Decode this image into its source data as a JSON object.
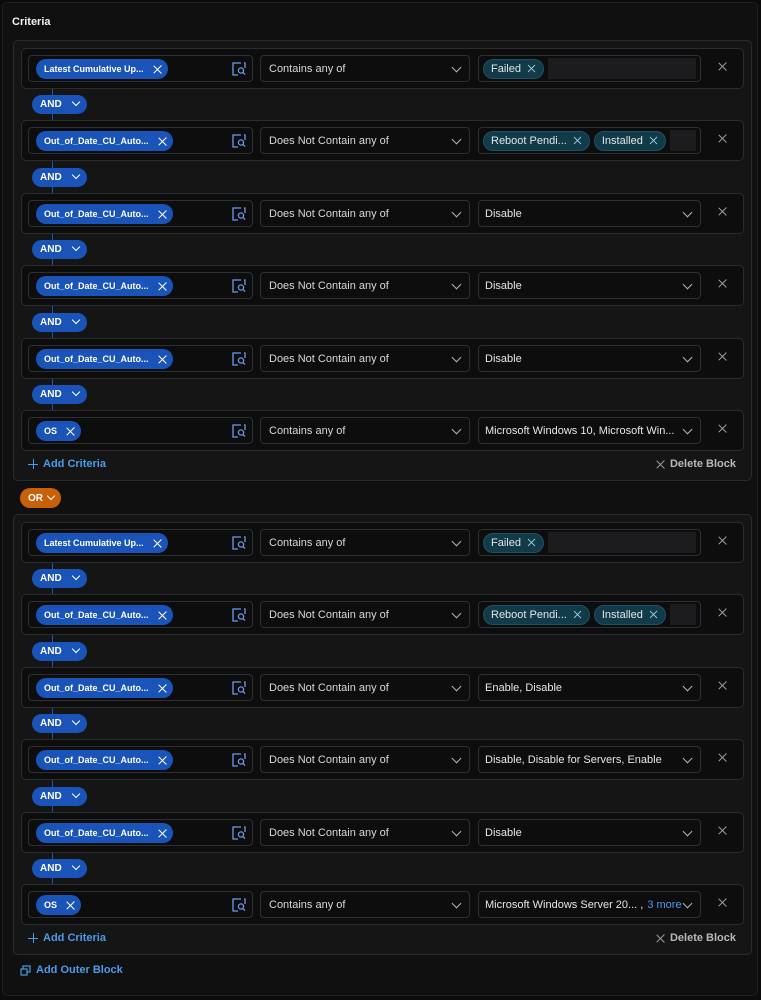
{
  "title": "Criteria",
  "blocks": [
    {
      "rows": [
        {
          "field": "Latest Cumulative Up...",
          "operator": "Contains any of",
          "value_type": "tags",
          "tags": [
            "Failed"
          ],
          "value_text": "",
          "more": ""
        },
        {
          "field": "Out_of_Date_CU_Auto...",
          "operator": "Does Not Contain any of",
          "value_type": "tags",
          "tags": [
            "Reboot Pendi...",
            "Installed"
          ],
          "value_text": "",
          "more": ""
        },
        {
          "field": "Out_of_Date_CU_Auto...",
          "operator": "Does Not Contain any of",
          "value_type": "select",
          "tags": [],
          "value_text": "Disable",
          "more": ""
        },
        {
          "field": "Out_of_Date_CU_Auto...",
          "operator": "Does Not Contain any of",
          "value_type": "select",
          "tags": [],
          "value_text": "Disable",
          "more": ""
        },
        {
          "field": "Out_of_Date_CU_Auto...",
          "operator": "Does Not Contain any of",
          "value_type": "select",
          "tags": [],
          "value_text": "Disable",
          "more": ""
        },
        {
          "field": "OS",
          "operator": "Contains any of",
          "value_type": "select",
          "tags": [],
          "value_text": "Microsoft Windows 10, Microsoft Win...",
          "more": ""
        }
      ],
      "connector": "AND",
      "add_criteria": "Add Criteria",
      "delete_block": "Delete Block"
    },
    {
      "rows": [
        {
          "field": "Latest Cumulative Up...",
          "operator": "Contains any of",
          "value_type": "tags",
          "tags": [
            "Failed"
          ],
          "value_text": "",
          "more": ""
        },
        {
          "field": "Out_of_Date_CU_Auto...",
          "operator": "Does Not Contain any of",
          "value_type": "tags",
          "tags": [
            "Reboot Pendi...",
            "Installed"
          ],
          "value_text": "",
          "more": ""
        },
        {
          "field": "Out_of_Date_CU_Auto...",
          "operator": "Does Not Contain any of",
          "value_type": "select",
          "tags": [],
          "value_text": "Enable, Disable",
          "more": ""
        },
        {
          "field": "Out_of_Date_CU_Auto...",
          "operator": "Does Not Contain any of",
          "value_type": "select",
          "tags": [],
          "value_text": "Disable, Disable for Servers, Enable",
          "more": ""
        },
        {
          "field": "Out_of_Date_CU_Auto...",
          "operator": "Does Not Contain any of",
          "value_type": "select",
          "tags": [],
          "value_text": "Disable",
          "more": ""
        },
        {
          "field": "OS",
          "operator": "Contains any of",
          "value_type": "select",
          "tags": [],
          "value_text": "Microsoft Windows Server 20... ,",
          "more": "3 more"
        }
      ],
      "connector": "AND",
      "add_criteria": "Add Criteria",
      "delete_block": "Delete Block"
    }
  ],
  "outer_connector": "OR",
  "add_outer_block": "Add Outer Block",
  "colors": {
    "and_chip": "#1a54b8",
    "or_chip": "#c85f09",
    "link": "#4a9ce8",
    "tag_bg": "#123b4a"
  }
}
